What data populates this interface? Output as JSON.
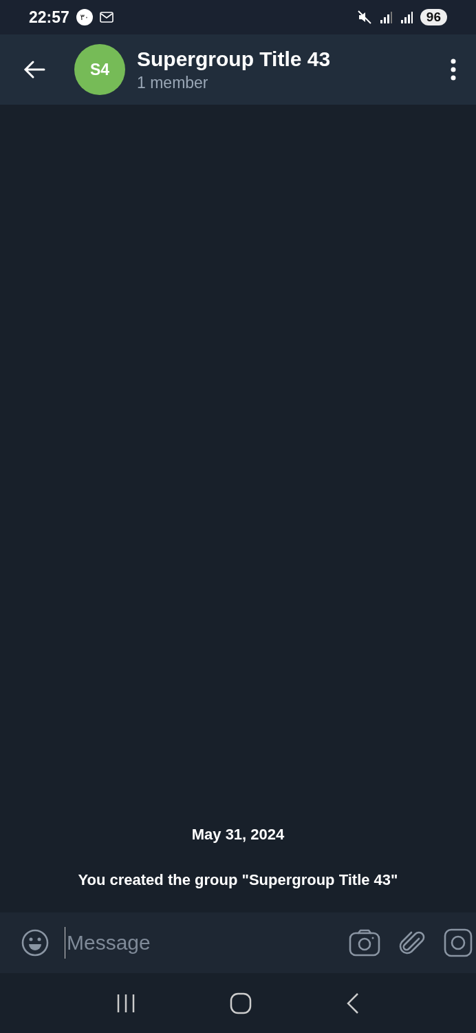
{
  "status_bar": {
    "time": "22:57",
    "notification_badge": "۳۰",
    "battery": "96"
  },
  "header": {
    "avatar_initials": "S4",
    "title": "Supergroup Title 43",
    "subtitle": "1 member"
  },
  "chat": {
    "date": "May 31, 2024",
    "service_message": "You created the group \"Supergroup Title 43\""
  },
  "composer": {
    "placeholder": "Message"
  }
}
